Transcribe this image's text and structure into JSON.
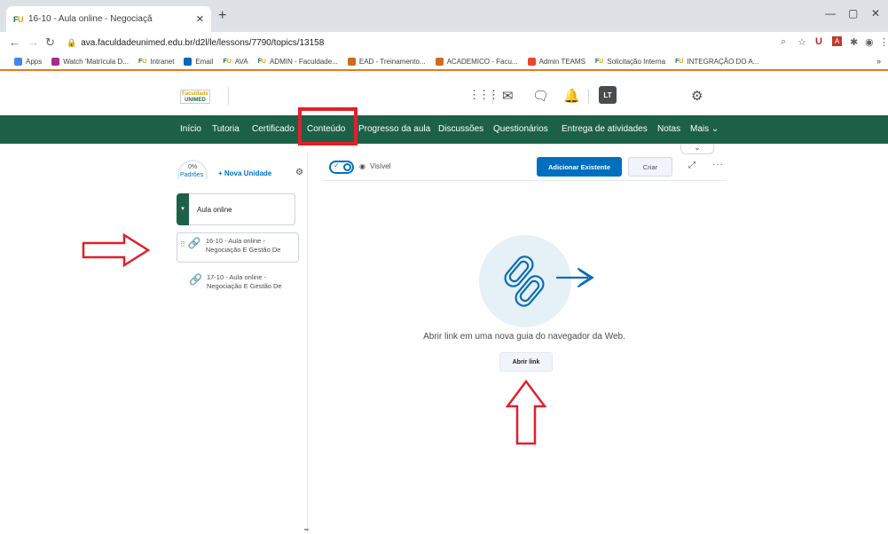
{
  "browser": {
    "tab_title": "16-10 - Aula online - Negociaçã",
    "new_tab": "+",
    "url": "ava.faculdadeunimed.edu.br/d2l/le/lessons/7790/topics/13158",
    "bookmarks": [
      {
        "label": "Apps",
        "color": "#4285f4"
      },
      {
        "label": "Watch 'Matrícula D...",
        "color": "#a62c8c"
      },
      {
        "label": "Intranet",
        "fu": true
      },
      {
        "label": "Email",
        "color": "#0a65b8"
      },
      {
        "label": "AVA",
        "fu": true
      },
      {
        "label": "ADMIN - Faculdade...",
        "fu": true
      },
      {
        "label": "EAD - Treinamento...",
        "color": "#d16a1e"
      },
      {
        "label": "ACADEMICO - Facu...",
        "color": "#d16a1e"
      },
      {
        "label": "Admin TEAMS",
        "color": "#e9472a"
      },
      {
        "label": "Solicitação Interna",
        "fu": true
      },
      {
        "label": "INTEGRAÇÃO DO A...",
        "fu": true
      }
    ],
    "bookmarks_more": "»"
  },
  "header": {
    "logo_line1": "Faculdade",
    "logo_line2": "UNIMED",
    "avatar_initials": "LT"
  },
  "nav": {
    "items": [
      "Início",
      "Tutoria",
      "Certificado",
      "Conteúdo",
      "Progresso da aula",
      "Discussões",
      "Questionários",
      "Entrega de atividades",
      "Notas",
      "Mais ⌄"
    ],
    "overflow_chevron": "⌄"
  },
  "left_panel": {
    "progress": "0%",
    "progress_label": "Padrões",
    "new_unit": "+ Nova Unidade",
    "unit_title": "Aula online",
    "lessons": [
      {
        "line1": "16-10 - Aula online -",
        "line2": "Negociação E Gestão De"
      },
      {
        "line1": "17-10 - Aula online -",
        "line2": "Negociação E Gestão De"
      }
    ]
  },
  "toolbar": {
    "visibility": "Visível",
    "add_existing": "Adicionar Existente",
    "create": "Criar"
  },
  "content": {
    "description": "Abrir link em uma nova guia do navegador da Web.",
    "open_link": "Abrir link"
  },
  "colors": {
    "nav_green": "#1c6047",
    "primary_blue": "#006fbf",
    "annotation_red": "#e0202a"
  }
}
